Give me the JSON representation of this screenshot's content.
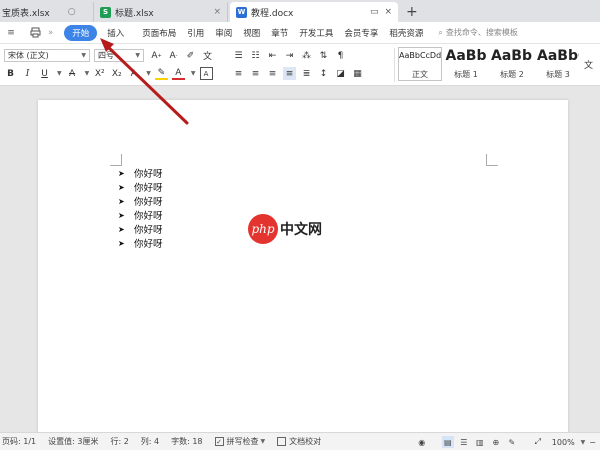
{
  "tabs": [
    {
      "label": "宝质表.xlsx",
      "icon_text": "",
      "icon_color": "",
      "active": false
    },
    {
      "label": "标题.xlsx",
      "icon_text": "S",
      "icon_color": "#1f9d55",
      "active": false
    },
    {
      "label": "教程.docx",
      "icon_text": "W",
      "icon_color": "#2b6fd6",
      "active": true
    }
  ],
  "menu": {
    "start": "开始",
    "items": [
      "插入",
      "页面布局",
      "引用",
      "审阅",
      "视图",
      "章节",
      "开发工具",
      "会员专享",
      "稻壳资源"
    ],
    "search_placeholder": "查找命令、搜索模板",
    "search_icon": "search-icon"
  },
  "ribbon": {
    "font_name": "宋体 (正文)",
    "font_size": "四号",
    "styles": [
      {
        "sample": "AaBbCcDd",
        "name": "正文",
        "big": false
      },
      {
        "sample": "AaBb",
        "name": "标题 1",
        "big": true
      },
      {
        "sample": "AaBb(",
        "name": "标题 2",
        "big": true
      },
      {
        "sample": "AaBbC",
        "name": "标题 3",
        "big": true
      }
    ]
  },
  "document": {
    "bullet_mark": "➤",
    "lines": [
      "你好呀",
      "你好呀",
      "你好呀",
      "你好呀",
      "你好呀",
      "你好呀"
    ],
    "watermark_logo": "php",
    "watermark_text": "中文网"
  },
  "status": {
    "page": "页码: 1/1",
    "section": "设置值: 3厘米",
    "row": "行: 2",
    "col": "列: 4",
    "words": "字数: 18",
    "spell": "拼写检查",
    "proof": "文档校对",
    "zoom": "100%"
  },
  "colors": {
    "accent": "#3c84e6",
    "arrow": "#b71c1c"
  }
}
